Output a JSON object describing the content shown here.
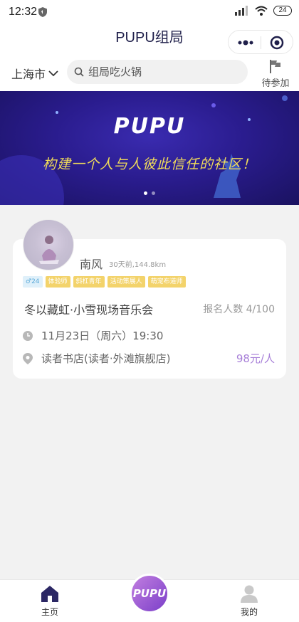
{
  "status": {
    "time": "12:32",
    "signal": "4G",
    "battery": "24"
  },
  "navbar": {
    "title": "PUPU组局"
  },
  "search": {
    "city": "上海市",
    "placeholder": "组局吃火锅",
    "pending_label": "待参加"
  },
  "banner": {
    "logo": "PUPU",
    "slogan": "构建一个人与人彼此信任的社区！",
    "active_slide": 1,
    "slide_count": 2
  },
  "event": {
    "user_name": "南风",
    "user_meta": "30天前,144.8km",
    "tags": [
      {
        "label": "♂24",
        "kind": "age"
      },
      {
        "label": "体验师",
        "kind": "yellow"
      },
      {
        "label": "斜杠青年",
        "kind": "yellow"
      },
      {
        "label": "活动策展人",
        "kind": "yellow"
      },
      {
        "label": "萌宠布道师",
        "kind": "yellow"
      }
    ],
    "title": "冬以藏虹·小雪现场音乐会",
    "signup": "报名人数 4/100",
    "time": "11月23日（周六）19:30",
    "place": "读者书店(读者·外滩旗舰店)",
    "price": "98元/人"
  },
  "tabbar": {
    "home": "主页",
    "center": "PUPU",
    "mine": "我的"
  },
  "colors": {
    "accent": "#a77fd8",
    "title": "#1f1f4a",
    "banner": "#2a1c8e",
    "tag_yellow": "#f3d36b"
  }
}
